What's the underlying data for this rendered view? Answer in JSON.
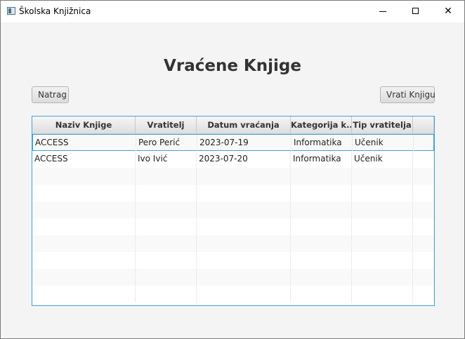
{
  "window": {
    "title": "Školska Knjižnica",
    "minimize_icon": "minimize-icon",
    "maximize_icon": "maximize-icon",
    "close_icon": "close-icon",
    "close_glyph": "✕"
  },
  "page": {
    "title": "Vraćene Knjige"
  },
  "toolbar": {
    "back_label": "Natrag",
    "return_label": "Vrati Knjigu"
  },
  "table": {
    "columns": [
      "Naziv Knjige",
      "Vratitelj",
      "Datum vraćanja",
      "Kategorija k...",
      "Tip vratitelja"
    ],
    "rows": [
      [
        "ACCESS",
        "Pero Perić",
        "2023-07-19",
        "Informatika",
        "Učenik"
      ],
      [
        "ACCESS",
        "Ivo Ivić",
        "2023-07-20",
        "Informatika",
        "Učenik"
      ]
    ],
    "empty_row_count": 8,
    "accent_color": "#3ea5d6"
  }
}
